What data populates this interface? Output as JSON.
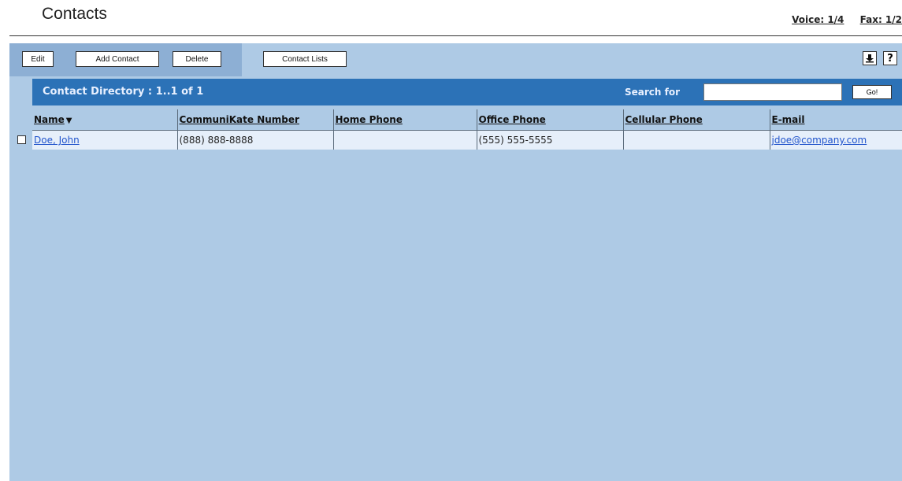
{
  "header": {
    "title": "Contacts",
    "voice_link": "Voice: 1/4",
    "fax_link": "Fax: 1/2"
  },
  "toolbar": {
    "edit_label": "Edit",
    "add_contact_label": "Add Contact",
    "delete_label": "Delete",
    "contact_lists_label": "Contact Lists",
    "icons": [
      "download-icon",
      "help-icon"
    ],
    "help_glyph": "?"
  },
  "directory": {
    "title": "Contact Directory : 1..1 of 1",
    "search_label": "Search for",
    "search_value": "",
    "go_label": "Go!"
  },
  "table": {
    "columns": [
      "Name",
      "CommuniKate Number",
      "Home Phone",
      "Office Phone",
      "Cellular Phone",
      "E-mail"
    ],
    "sort_indicator": "▼",
    "rows": [
      {
        "name": "Doe, John",
        "communikate": "(888) 888-8888",
        "home": "",
        "office": "(555) 555-5555",
        "cellular": "",
        "email": "jdoe@company.com"
      }
    ]
  },
  "colors": {
    "panel_bg": "#aecae5",
    "toolbar_tab": "#8dafd4",
    "directory_header": "#2c72b7",
    "row_bg": "#e6effa",
    "link": "#2255cc"
  }
}
